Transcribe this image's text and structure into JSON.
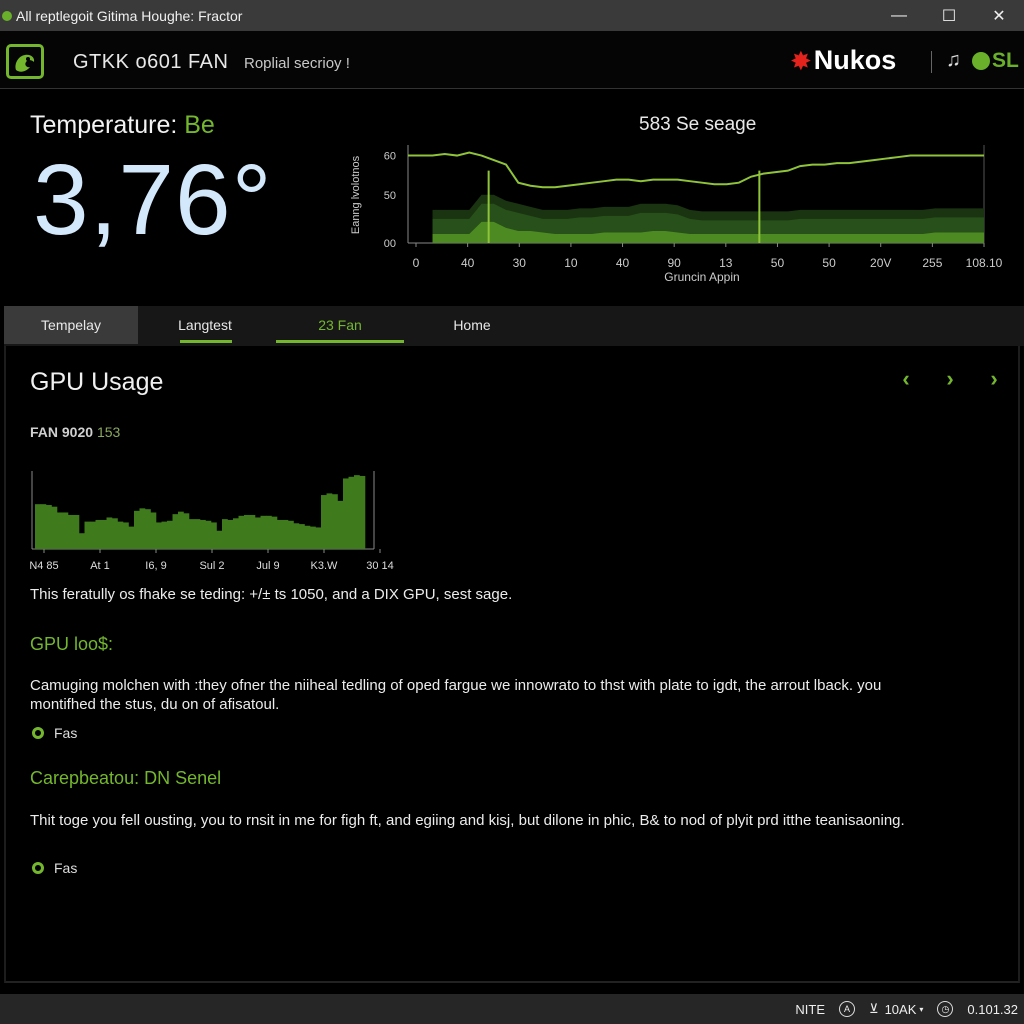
{
  "window": {
    "title": "All reptlegoit Gitima Houghe: Fractor",
    "controls": {
      "minimize": "—",
      "maximize": "☐",
      "close": "✕"
    }
  },
  "header": {
    "product": "GTKK o601 FAN",
    "subtitle": "Roplial secrioy !",
    "brand": {
      "name": "Nukos",
      "burst": "✸"
    },
    "music_icon": "♫",
    "osl": "SL"
  },
  "temperature": {
    "label": "Temperature:",
    "label_accent": "Be",
    "value": "3,76°"
  },
  "tabs": [
    {
      "label": "Tempelay",
      "active": true
    },
    {
      "label": "Langtest",
      "active": false
    },
    {
      "label": "23 Fan",
      "active": false
    },
    {
      "label": "Home",
      "active": false
    }
  ],
  "panel": {
    "title": "GPU Usage",
    "nav": {
      "prev": "‹",
      "next": "›",
      "next2": "›"
    },
    "fan_label": "FAN 9020",
    "fan_value": "153",
    "description": "This feratully os fhake se teding: +/± ts 1050, and a DIX GPU, sest sage.",
    "sections": [
      {
        "title": "GPU loo$:",
        "body": "Camuging molchen with :they ofner the niiheal tedling of oped fargue we innowrato to thst with plate to igdt, the arrout lback. you montifhed the stus, du on of afisatoul.",
        "option": "Fas"
      },
      {
        "title": "Carepbeatou: DN Senel",
        "body": "Thit toge you fell ousting, you to rnsit in me for figh ft, and egiing and kisj, but dilone in phic, B& to nod of plyit prd itthe teanisaoning.",
        "option": "Fas"
      }
    ]
  },
  "statusbar": {
    "mode": "NITE",
    "speed": "10AK",
    "time": "0.101.32"
  },
  "chart_data": [
    {
      "type": "line",
      "title": "583 Se seage",
      "xlabel": "Gruncin Appin",
      "ylabel": "Eanng lvolotnos",
      "x_ticks": [
        "0",
        "40",
        "30",
        "10",
        "40",
        "90",
        "13",
        "50",
        "50",
        "20V",
        "255",
        "108.10"
      ],
      "y_ticks": [
        "00",
        "50",
        "60"
      ],
      "ylim": [
        0,
        65
      ],
      "series": [
        {
          "name": "main",
          "values": [
            58,
            58,
            58,
            59,
            58,
            60,
            58,
            55,
            52,
            40,
            38,
            37,
            37,
            38,
            39,
            40,
            41,
            42,
            42,
            41,
            42,
            42,
            42,
            41,
            40,
            39,
            39,
            40,
            44,
            46,
            47,
            48,
            51,
            52,
            52,
            53,
            53,
            54,
            55,
            56,
            57,
            58,
            58,
            58,
            58,
            58,
            58,
            58
          ]
        },
        {
          "name": "band-upper",
          "values": [
            16,
            16,
            16,
            16,
            16,
            16,
            26,
            26,
            22,
            20,
            18,
            16,
            16,
            16,
            17,
            17,
            18,
            18,
            18,
            20,
            20,
            20,
            19,
            16,
            15,
            15,
            15,
            15,
            15,
            15,
            15,
            15,
            16,
            16,
            16,
            16,
            16,
            16,
            16,
            16,
            16,
            16,
            16,
            17,
            17,
            17,
            17,
            17
          ]
        },
        {
          "name": "band-lower",
          "values": [
            6,
            6,
            6,
            6,
            6,
            6,
            14,
            14,
            10,
            8,
            8,
            7,
            6,
            6,
            6,
            6,
            7,
            7,
            7,
            7,
            8,
            8,
            7,
            6,
            6,
            6,
            6,
            6,
            6,
            6,
            6,
            6,
            6,
            6,
            6,
            6,
            6,
            6,
            6,
            6,
            6,
            6,
            6,
            7,
            7,
            7,
            7,
            7
          ]
        }
      ],
      "markers": [
        0.14,
        0.61
      ]
    },
    {
      "type": "bar",
      "title": "FAN 9020 153",
      "x_ticks": [
        "N4 85",
        "At 1",
        "I6, 9",
        "Sul 2",
        "Jul 9",
        "K3.W",
        "30 14"
      ],
      "ylim": [
        0,
        100
      ],
      "values": [
        54,
        54,
        53,
        51,
        44,
        44,
        41,
        41,
        19,
        33,
        33,
        35,
        35,
        38,
        37,
        33,
        32,
        27,
        46,
        49,
        48,
        44,
        32,
        33,
        34,
        42,
        45,
        43,
        36,
        36,
        35,
        34,
        32,
        22,
        36,
        35,
        37,
        40,
        41,
        41,
        38,
        40,
        40,
        39,
        35,
        35,
        34,
        31,
        30,
        28,
        27,
        26,
        65,
        67,
        66,
        58,
        85,
        87,
        89,
        88
      ]
    }
  ]
}
